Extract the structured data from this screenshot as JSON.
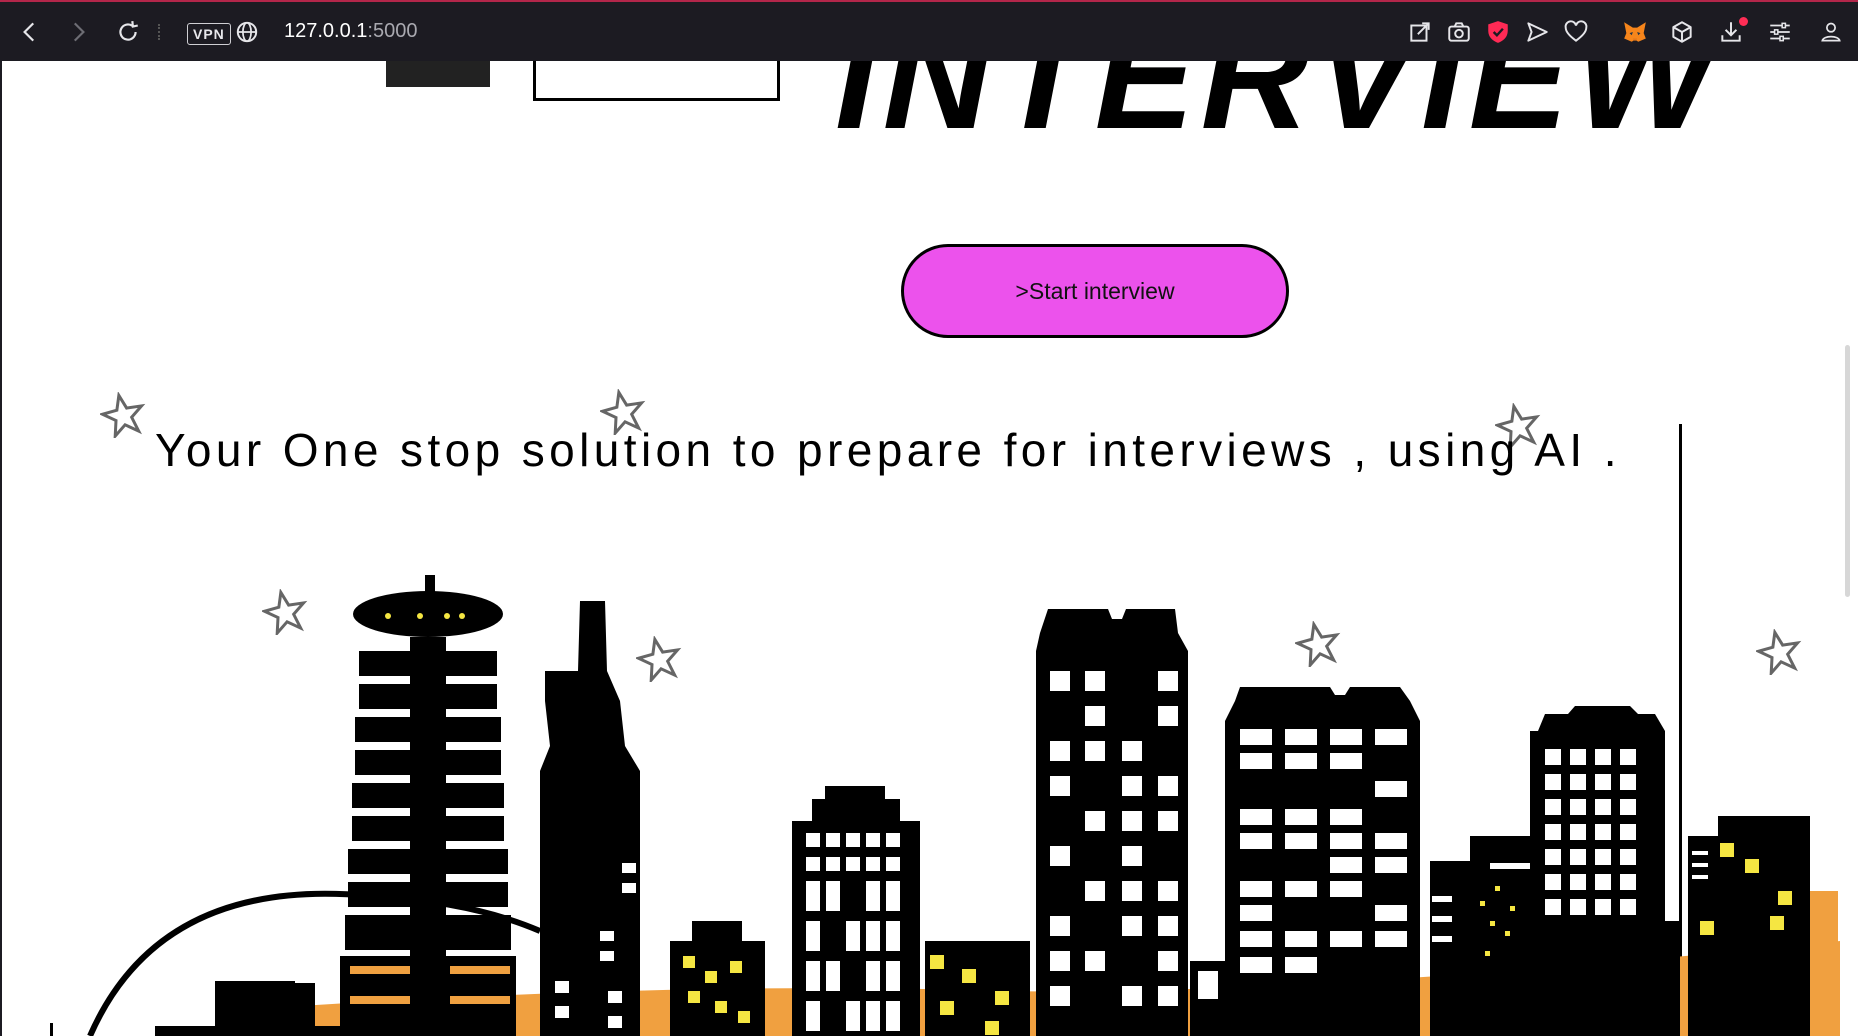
{
  "browser": {
    "vpn_label": "VPN",
    "url_host": "127.0.0.1",
    "url_port": ":5000",
    "icons": [
      "back-icon",
      "forward-icon",
      "reload-icon",
      "globe-icon",
      "share-icon",
      "camera-icon",
      "shield-icon",
      "send-icon",
      "heart-icon",
      "fox-extension-icon",
      "cube-icon",
      "download-icon",
      "settings-sliders-icon",
      "profile-icon"
    ]
  },
  "page": {
    "hero_title": "INTERVIEW",
    "start_button_label": ">Start interview",
    "tagline": "Your One stop solution to prepare for interviews , using AI ."
  },
  "colors": {
    "browser_bar": "#1c1b22",
    "button_bg": "#ec52ec",
    "window_yellow": "#f5e642",
    "ground_orange": "#f0a040"
  }
}
